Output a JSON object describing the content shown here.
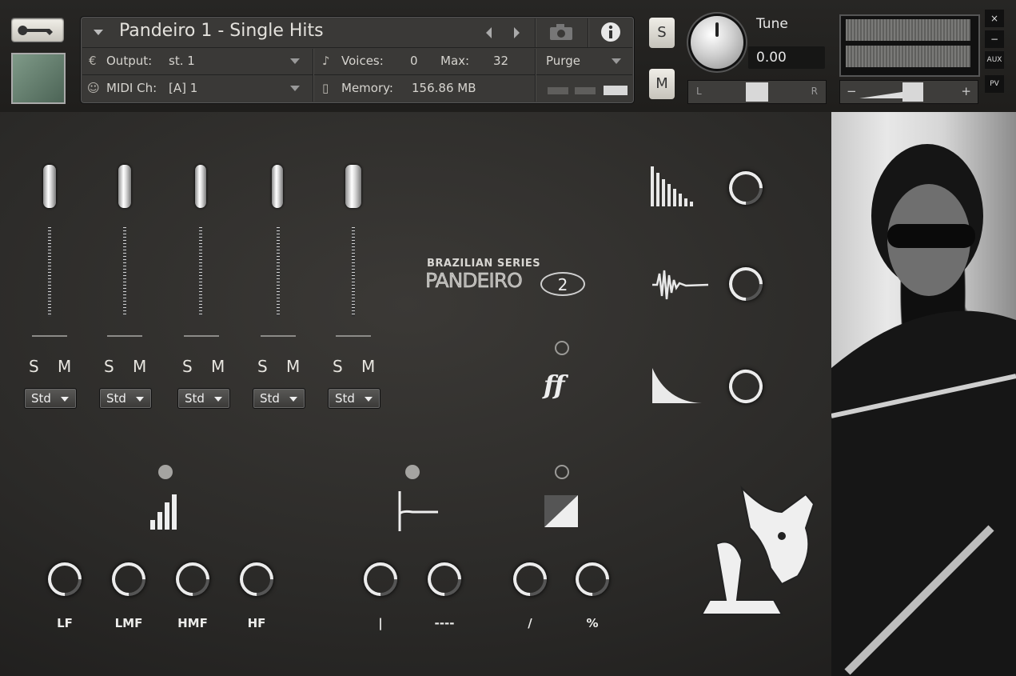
{
  "header": {
    "instrument_name": "Pandeiro 1 - Single Hits",
    "output_label": "Output:",
    "output_value": "st. 1",
    "midi_label": "MIDI Ch:",
    "midi_value": "[A]  1",
    "voices_label": "Voices:",
    "voices_value": "0",
    "max_label": "Max:",
    "max_value": "32",
    "memory_label": "Memory:",
    "memory_value": "156.86 MB",
    "purge_label": "Purge",
    "solo_label": "S",
    "mute_label": "M",
    "tune_label": "Tune",
    "tune_value": "0.00",
    "pan_left": "L",
    "pan_right": "R",
    "vol_minus": "−",
    "vol_plus": "+",
    "aux_label": "AUX",
    "pv_label": "PV",
    "close_label": "×",
    "minimize_label": "−"
  },
  "logo": {
    "series": "BRAZILIAN SERIES",
    "name": "PANDEIRO",
    "number": "2"
  },
  "mixer": {
    "channels": [
      {
        "solo": "S",
        "mute": "M",
        "mode": "Std"
      },
      {
        "solo": "S",
        "mute": "M",
        "mode": "Std"
      },
      {
        "solo": "S",
        "mute": "M",
        "mode": "Std"
      },
      {
        "solo": "S",
        "mute": "M",
        "mode": "Std"
      },
      {
        "solo": "S",
        "mute": "M",
        "mode": "Std"
      }
    ]
  },
  "dynamics_label": "ff",
  "eq": {
    "labels": [
      "LF",
      "LMF",
      "HMF",
      "HF"
    ]
  },
  "reverb": {
    "labels": [
      "|",
      "----"
    ]
  },
  "drive": {
    "labels": [
      "/",
      "%"
    ]
  },
  "colors": {
    "accent": "#ececea",
    "background": "#2b2a28",
    "panel": "#3a3937"
  }
}
